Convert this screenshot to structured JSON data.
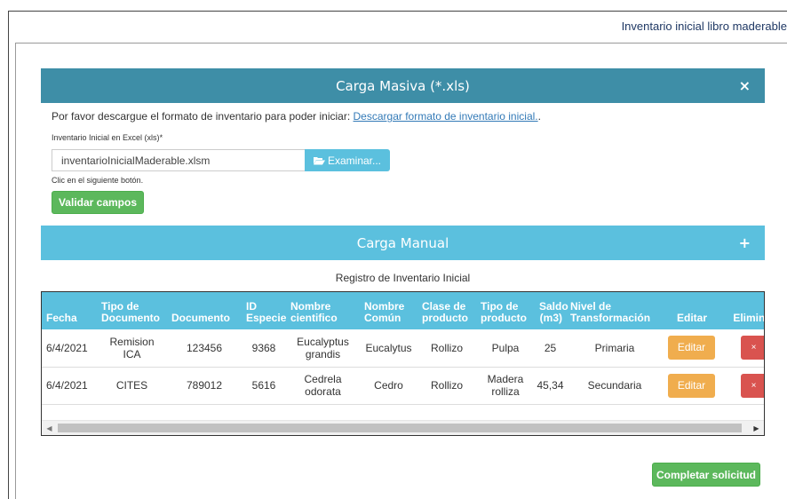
{
  "page": {
    "title": "Inventario inicial libro maderable"
  },
  "masiva": {
    "title": "Carga Masiva (*.xls)",
    "close_icon": "×",
    "intro_text": "Por favor descargue el formato de inventario para poder iniciar: ",
    "download_link": "Descargar formato de inventario inicial.",
    "intro_end": ".",
    "field_label": "Inventario Inicial en Excel (xls)",
    "required_mark": "*",
    "file_value": "inventarioInicialMaderable.xlsm",
    "browse_icon": "folder-open-icon",
    "browse_label": "Examinar...",
    "hint": "Clic en el siguiente botón.",
    "validate_label": "Validar campos"
  },
  "manual": {
    "title": "Carga Manual",
    "expand_icon": "+"
  },
  "registry": {
    "caption": "Registro de Inventario Inicial",
    "headers": {
      "fecha": "Fecha",
      "tipo_doc_1": "Tipo de",
      "tipo_doc_2": "Documento",
      "documento": "Documento",
      "id_1": "ID",
      "id_2": "Especie",
      "nombre_cient_1": "Nombre",
      "nombre_cient_2": "cientifico",
      "nombre_comun_1": "Nombre",
      "nombre_comun_2": "Común",
      "clase_1": "Clase de",
      "clase_2": "producto",
      "tipo_prod_1": "Tipo de",
      "tipo_prod_2": "producto",
      "saldo_1": "Saldo",
      "saldo_2": "(m3)",
      "nivel_1": "Nivel de",
      "nivel_2": "Transformación",
      "editar": "Editar",
      "eliminar": "Eliminar"
    },
    "rows": [
      {
        "fecha": "6/4/2021",
        "tipo_doc_1": "Remision",
        "tipo_doc_2": "ICA",
        "documento": "123456",
        "id_especie": "9368",
        "nombre_cient_1": "Eucalyptus",
        "nombre_cient_2": "grandis",
        "nombre_comun": "Eucalytus",
        "clase": "Rollizo",
        "tipo_prod_1": "Pulpa",
        "tipo_prod_2": "",
        "saldo": "25",
        "nivel": "Primaria",
        "edit_label": "Editar",
        "delete_label": "×"
      },
      {
        "fecha": "6/4/2021",
        "tipo_doc_1": "CITES",
        "tipo_doc_2": "",
        "documento": "789012",
        "id_especie": "5616",
        "nombre_cient_1": "Cedrela",
        "nombre_cient_2": "odorata",
        "nombre_comun": "Cedro",
        "clase": "Rollizo",
        "tipo_prod_1": "Madera",
        "tipo_prod_2": "rolliza",
        "saldo": "45,34",
        "nivel": "Secundaria",
        "edit_label": "Editar",
        "delete_label": "×"
      }
    ],
    "scroll_left": "◀",
    "scroll_right": "▶"
  },
  "footer": {
    "complete_label": "Completar solicitud"
  }
}
